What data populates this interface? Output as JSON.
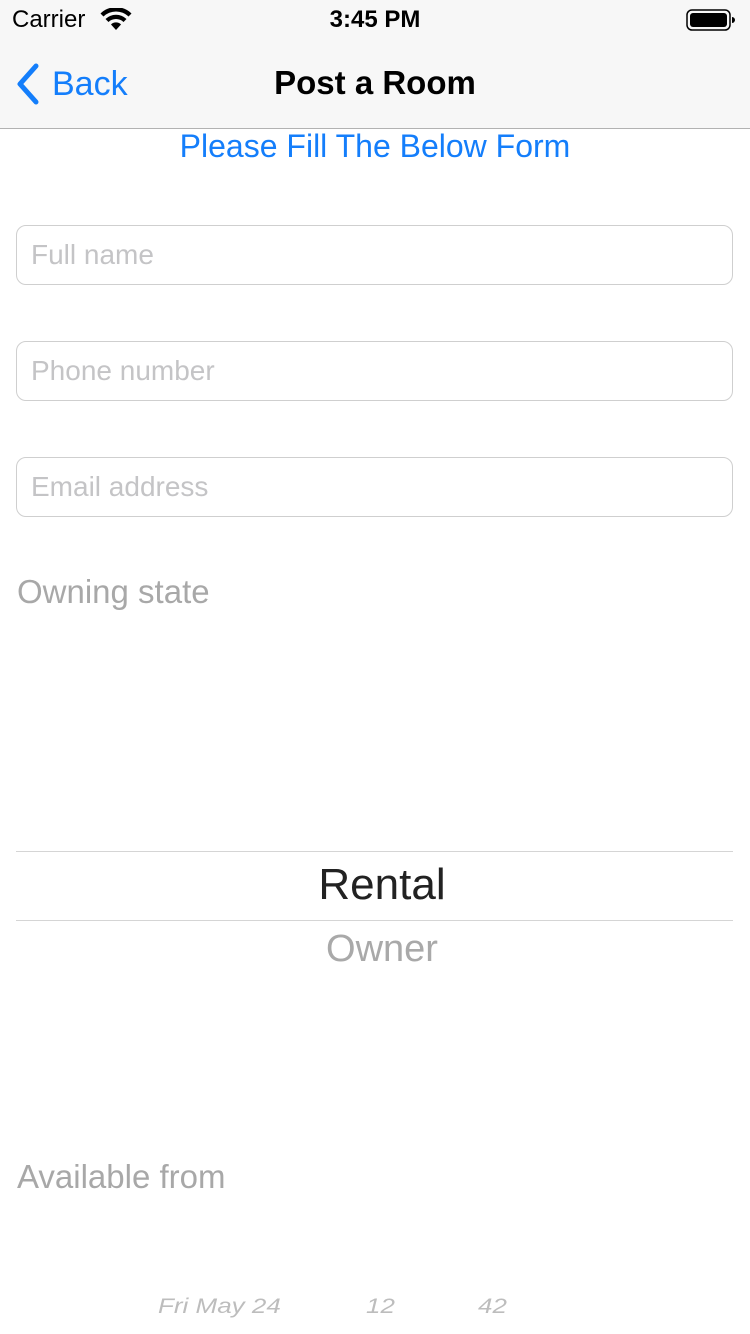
{
  "status_bar": {
    "carrier": "Carrier",
    "time": "3:45 PM"
  },
  "nav": {
    "back_label": "Back",
    "title": "Post a Room"
  },
  "form": {
    "heading": "Please Fill The Below Form",
    "full_name": {
      "placeholder": "Full name",
      "value": ""
    },
    "phone": {
      "placeholder": "Phone number",
      "value": ""
    },
    "email": {
      "placeholder": "Email address",
      "value": ""
    },
    "owning_state": {
      "label": "Owning state",
      "selected": "Rental",
      "options": [
        "Rental",
        "Owner"
      ]
    },
    "available_from": {
      "label": "Available from",
      "selected_day": "Fri May 24",
      "selected_hour": "12",
      "selected_minute": "42"
    }
  },
  "colors": {
    "accent": "#147efb",
    "placeholder": "#c4c4c6",
    "label_gray": "#a8a8a8"
  }
}
